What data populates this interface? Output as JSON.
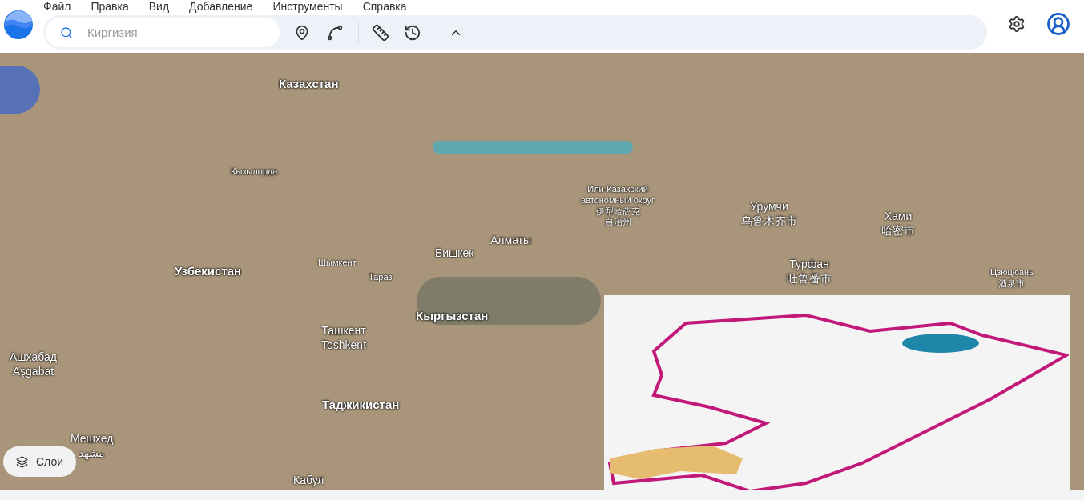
{
  "menu": [
    "Файл",
    "Правка",
    "Вид",
    "Добавление",
    "Инструменты",
    "Справка"
  ],
  "search": {
    "placeholder": "Киргизия"
  },
  "map_labels": [
    {
      "kind": "country",
      "lines": [
        "Казахстан"
      ]
    },
    {
      "kind": "city",
      "lines": [
        "Кызылорда"
      ]
    },
    {
      "kind": "country",
      "lines": [
        "Узбекистан"
      ]
    },
    {
      "kind": "city",
      "lines": [
        "Шымкент"
      ]
    },
    {
      "kind": "city",
      "lines": [
        "Тараз"
      ]
    },
    {
      "kind": "capital",
      "lines": [
        "Бишкек"
      ]
    },
    {
      "kind": "capital",
      "lines": [
        "Алматы"
      ]
    },
    {
      "kind": "country",
      "lines": [
        "Кыргызстан"
      ]
    },
    {
      "kind": "capital",
      "lines": [
        "Ташкент",
        "Toshkent"
      ]
    },
    {
      "kind": "capital",
      "lines": [
        "Ашхабад",
        "Aşgabat"
      ]
    },
    {
      "kind": "country",
      "lines": [
        "Таджикистан"
      ]
    },
    {
      "kind": "capital",
      "lines": [
        "Мешхед",
        "مشهد"
      ]
    },
    {
      "kind": "capital",
      "lines": [
        "Кабул"
      ]
    },
    {
      "kind": "city",
      "lines": [
        "Или-Казахский",
        "автономный округ",
        "伊犁哈萨克",
        "自治州"
      ]
    },
    {
      "kind": "capital",
      "lines": [
        "Урумчи",
        "乌鲁木齐市"
      ]
    },
    {
      "kind": "capital",
      "lines": [
        "Хами",
        "哈密市"
      ]
    },
    {
      "kind": "capital",
      "lines": [
        "Турфан",
        "吐鲁番市"
      ]
    },
    {
      "kind": "city",
      "lines": [
        "Цзюцюань",
        "酒泉市"
      ]
    }
  ],
  "layers_button": "Слои"
}
